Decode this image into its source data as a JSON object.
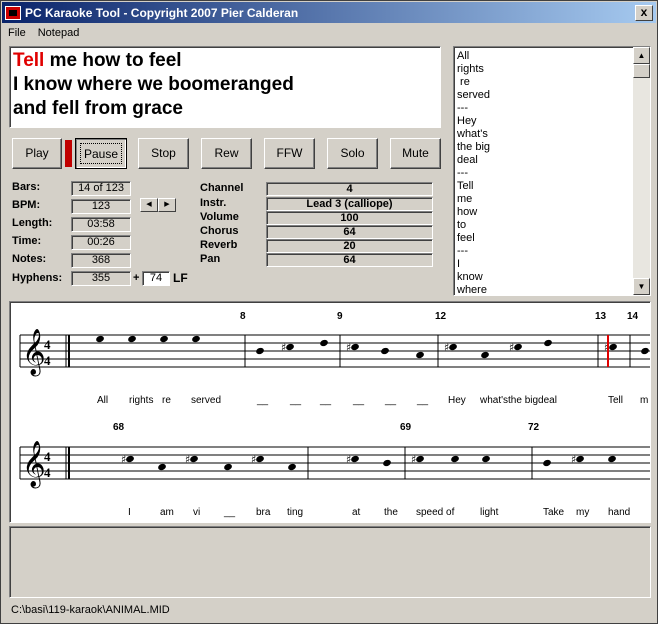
{
  "window": {
    "title": "PC Karaoke Tool - Copyright 2007 Pier Calderan",
    "close_label": "x"
  },
  "menu": [
    "File",
    "Notepad"
  ],
  "lyrics_display": {
    "line1_highlight": "Tell",
    "line1_rest": " me how to feel",
    "line2": "I know where we boomeranged",
    "line3": "and fell from grace"
  },
  "lyric_list": [
    "All",
    "rights",
    " re",
    "served",
    "---",
    "Hey",
    "what's",
    "the big",
    "deal",
    "---",
    "Tell",
    "me",
    "how",
    "to",
    "feel",
    "---",
    "I",
    "know",
    "where"
  ],
  "buttons": {
    "play": "Play",
    "pause": "Pause",
    "stop": "Stop",
    "rew": "Rew",
    "ffw": "FFW",
    "solo": "Solo",
    "mute": "Mute"
  },
  "info": {
    "bars_label": "Bars:",
    "bars_value": "14 of 123",
    "bpm_label": "BPM:",
    "bpm_value": "123",
    "length_label": "Length:",
    "length_value": "03:58",
    "time_label": "Time:",
    "time_value": "00:26",
    "notes_label": "Notes:",
    "notes_value": "368",
    "hyphens_label": "Hyphens:",
    "hyphens_value": "355",
    "plus": "+",
    "lf_value": "74",
    "lf_label": "LF"
  },
  "channel": {
    "channel_label": "Channel",
    "channel_value": "4",
    "instr_label": "Instr.",
    "instr_value": "Lead 3 (calliope)",
    "volume_label": "Volume",
    "volume_value": "100",
    "chorus_label": "Chorus",
    "chorus_value": "64",
    "reverb_label": "Reverb",
    "reverb_value": "20",
    "pan_label": "Pan",
    "pan_value": "64"
  },
  "score": {
    "time_sig_top": "4",
    "time_sig_bottom": "4",
    "row1_measures": [
      "8",
      "9",
      "12",
      "13",
      "14"
    ],
    "row1_lyrics": [
      "All",
      "rights",
      "re",
      "served",
      "__",
      "__",
      "__",
      "__",
      "__",
      "__",
      "Hey",
      "what'sthe bigdeal",
      "Tell",
      "m"
    ],
    "row2_measures": [
      "68",
      "69",
      "72"
    ],
    "row2_lyrics": [
      "I",
      "am",
      "vi",
      "__",
      "bra",
      "ting",
      "at",
      "the",
      "speed of",
      "light",
      "Take",
      "my",
      "hand"
    ]
  },
  "status": {
    "path": "C:\\basi\\119-karaok\\ANIMAL.MID"
  }
}
